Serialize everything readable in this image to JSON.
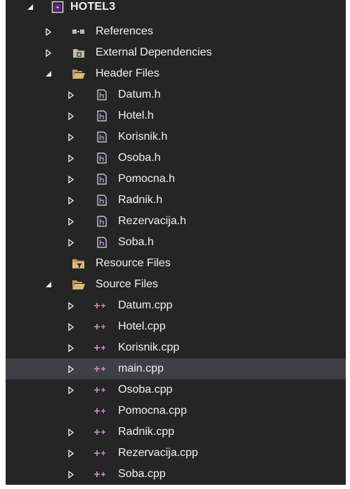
{
  "project": {
    "label": "HOTEL3",
    "expanded": true,
    "icon": "cpp-project-icon"
  },
  "references": {
    "label": "References",
    "expanded": false,
    "icon": "references-icon"
  },
  "external_dependencies": {
    "label": "External Dependencies",
    "expanded": false,
    "icon": "external-dependencies-icon"
  },
  "header_files": {
    "label": "Header Files",
    "expanded": true,
    "icon": "open-folder-filter-icon",
    "items": [
      {
        "label": "Datum.h",
        "expandable": true,
        "icon": "header-file-icon"
      },
      {
        "label": "Hotel.h",
        "expandable": true,
        "icon": "header-file-icon"
      },
      {
        "label": "Korisnik.h",
        "expandable": true,
        "icon": "header-file-icon"
      },
      {
        "label": "Osoba.h",
        "expandable": true,
        "icon": "header-file-icon"
      },
      {
        "label": "Pomocna.h",
        "expandable": true,
        "icon": "header-file-icon"
      },
      {
        "label": "Radnik.h",
        "expandable": true,
        "icon": "header-file-icon"
      },
      {
        "label": "Rezervacija.h",
        "expandable": true,
        "icon": "header-file-icon"
      },
      {
        "label": "Soba.h",
        "expandable": true,
        "icon": "header-file-icon"
      }
    ]
  },
  "resource_files": {
    "label": "Resource Files",
    "expanded": false,
    "icon": "folder-filter-icon"
  },
  "source_files": {
    "label": "Source Files",
    "expanded": true,
    "icon": "open-folder-filter-icon",
    "items": [
      {
        "label": "Datum.cpp",
        "expandable": true,
        "selected": false,
        "icon": "cpp-file-icon"
      },
      {
        "label": "Hotel.cpp",
        "expandable": true,
        "selected": false,
        "icon": "cpp-file-icon"
      },
      {
        "label": "Korisnik.cpp",
        "expandable": true,
        "selected": false,
        "icon": "cpp-file-icon"
      },
      {
        "label": "main.cpp",
        "expandable": true,
        "selected": true,
        "icon": "cpp-file-icon"
      },
      {
        "label": "Osoba.cpp",
        "expandable": true,
        "selected": false,
        "icon": "cpp-file-icon"
      },
      {
        "label": "Pomocna.cpp",
        "expandable": false,
        "selected": false,
        "icon": "cpp-file-icon"
      },
      {
        "label": "Radnik.cpp",
        "expandable": true,
        "selected": false,
        "icon": "cpp-file-icon"
      },
      {
        "label": "Rezervacija.cpp",
        "expandable": true,
        "selected": false,
        "icon": "cpp-file-icon"
      },
      {
        "label": "Soba.cpp",
        "expandable": true,
        "selected": false,
        "icon": "cpp-file-icon"
      }
    ]
  },
  "colors": {
    "background": "#252526",
    "selection": "#3f3f46",
    "text": "#f1f1f1",
    "folder": "#dcb67a",
    "cpp_accent": "#c586c0",
    "header_accent": "#b180d7"
  }
}
